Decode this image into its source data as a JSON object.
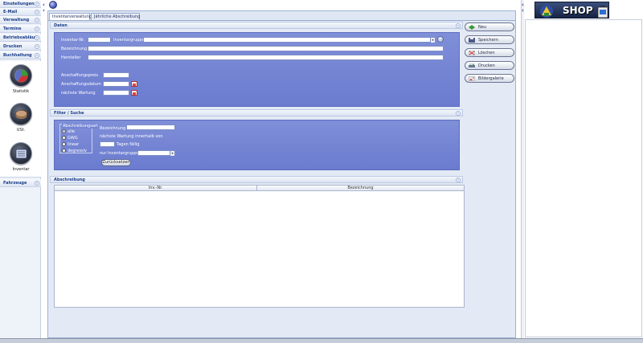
{
  "sidebar": {
    "items_top": [
      {
        "label": "Einstellungen"
      },
      {
        "label": "E-Mail"
      },
      {
        "label": "Verwaltung"
      },
      {
        "label": "Termine"
      },
      {
        "label": "Betriebsabläufe"
      },
      {
        "label": "Drucken"
      },
      {
        "label": "Buchhaltung"
      }
    ],
    "accordion": [
      {
        "label": "Statistik",
        "icon": "chart-icon"
      },
      {
        "label": "USt.",
        "icon": "coin-icon"
      },
      {
        "label": "Inventar",
        "icon": "inventory-icon"
      }
    ],
    "items_bottom": [
      {
        "label": "Fahrzeuge"
      }
    ]
  },
  "tabs": [
    {
      "label": "Inventarverwaltung",
      "active": true
    },
    {
      "label": "Jährliche Abschreibung",
      "active": false
    }
  ],
  "daten": {
    "title": "Daten",
    "inventar_nr_label": "Inventar-Nr.",
    "inventar_nr_value": "",
    "inventargruppe_label": "Inventargruppe",
    "inventargruppe_value": "",
    "bezeichnung_label": "Bezeichnung",
    "bezeichnung_value": "",
    "hersteller_label": "Hersteller",
    "hersteller_value": "",
    "anschaffungspreis_label": "Anschaffungspreis",
    "anschaffungspreis_value": "",
    "anschaffungsdatum_label": "Anschaffungsdatum",
    "anschaffungsdatum_value": "",
    "naechste_wartung_label": "nächste Wartung",
    "naechste_wartung_value": ""
  },
  "filter": {
    "title": "Filter / Suche",
    "abschreibungsart_label": "Abschreibungsart",
    "options": [
      {
        "label": "alle",
        "selected": true
      },
      {
        "label": "GWG",
        "selected": false
      },
      {
        "label": "linear",
        "selected": false
      },
      {
        "label": "degressiv",
        "selected": false
      }
    ],
    "bezeichnung_label": "Bezeichnung",
    "bezeichnung_value": "",
    "wartung_label": "nächste Wartung innerhalb von",
    "tage_value": "",
    "tage_label": "Tagen fällig",
    "gruppe_label": "nur Inventargruppe",
    "gruppe_value": "",
    "reset_label": "Zurücksetzen"
  },
  "abschreibung": {
    "title": "Abschreibung",
    "columns": [
      "Inv.-Nr.",
      "Bezeichnung"
    ],
    "rows": []
  },
  "actions": [
    {
      "label": "Neu",
      "icon": "new-icon"
    },
    {
      "label": "Speichern",
      "icon": "save-icon"
    },
    {
      "label": "Löschen",
      "icon": "delete-icon"
    },
    {
      "label": "Drucken",
      "icon": "print-icon"
    },
    {
      "label": "Bildergalerie",
      "icon": "gallery-icon"
    }
  ],
  "shop": {
    "banner_text": "SHOP"
  },
  "colors": {
    "accent": "#6b7bcf",
    "nav_text": "#1e3f8a"
  }
}
